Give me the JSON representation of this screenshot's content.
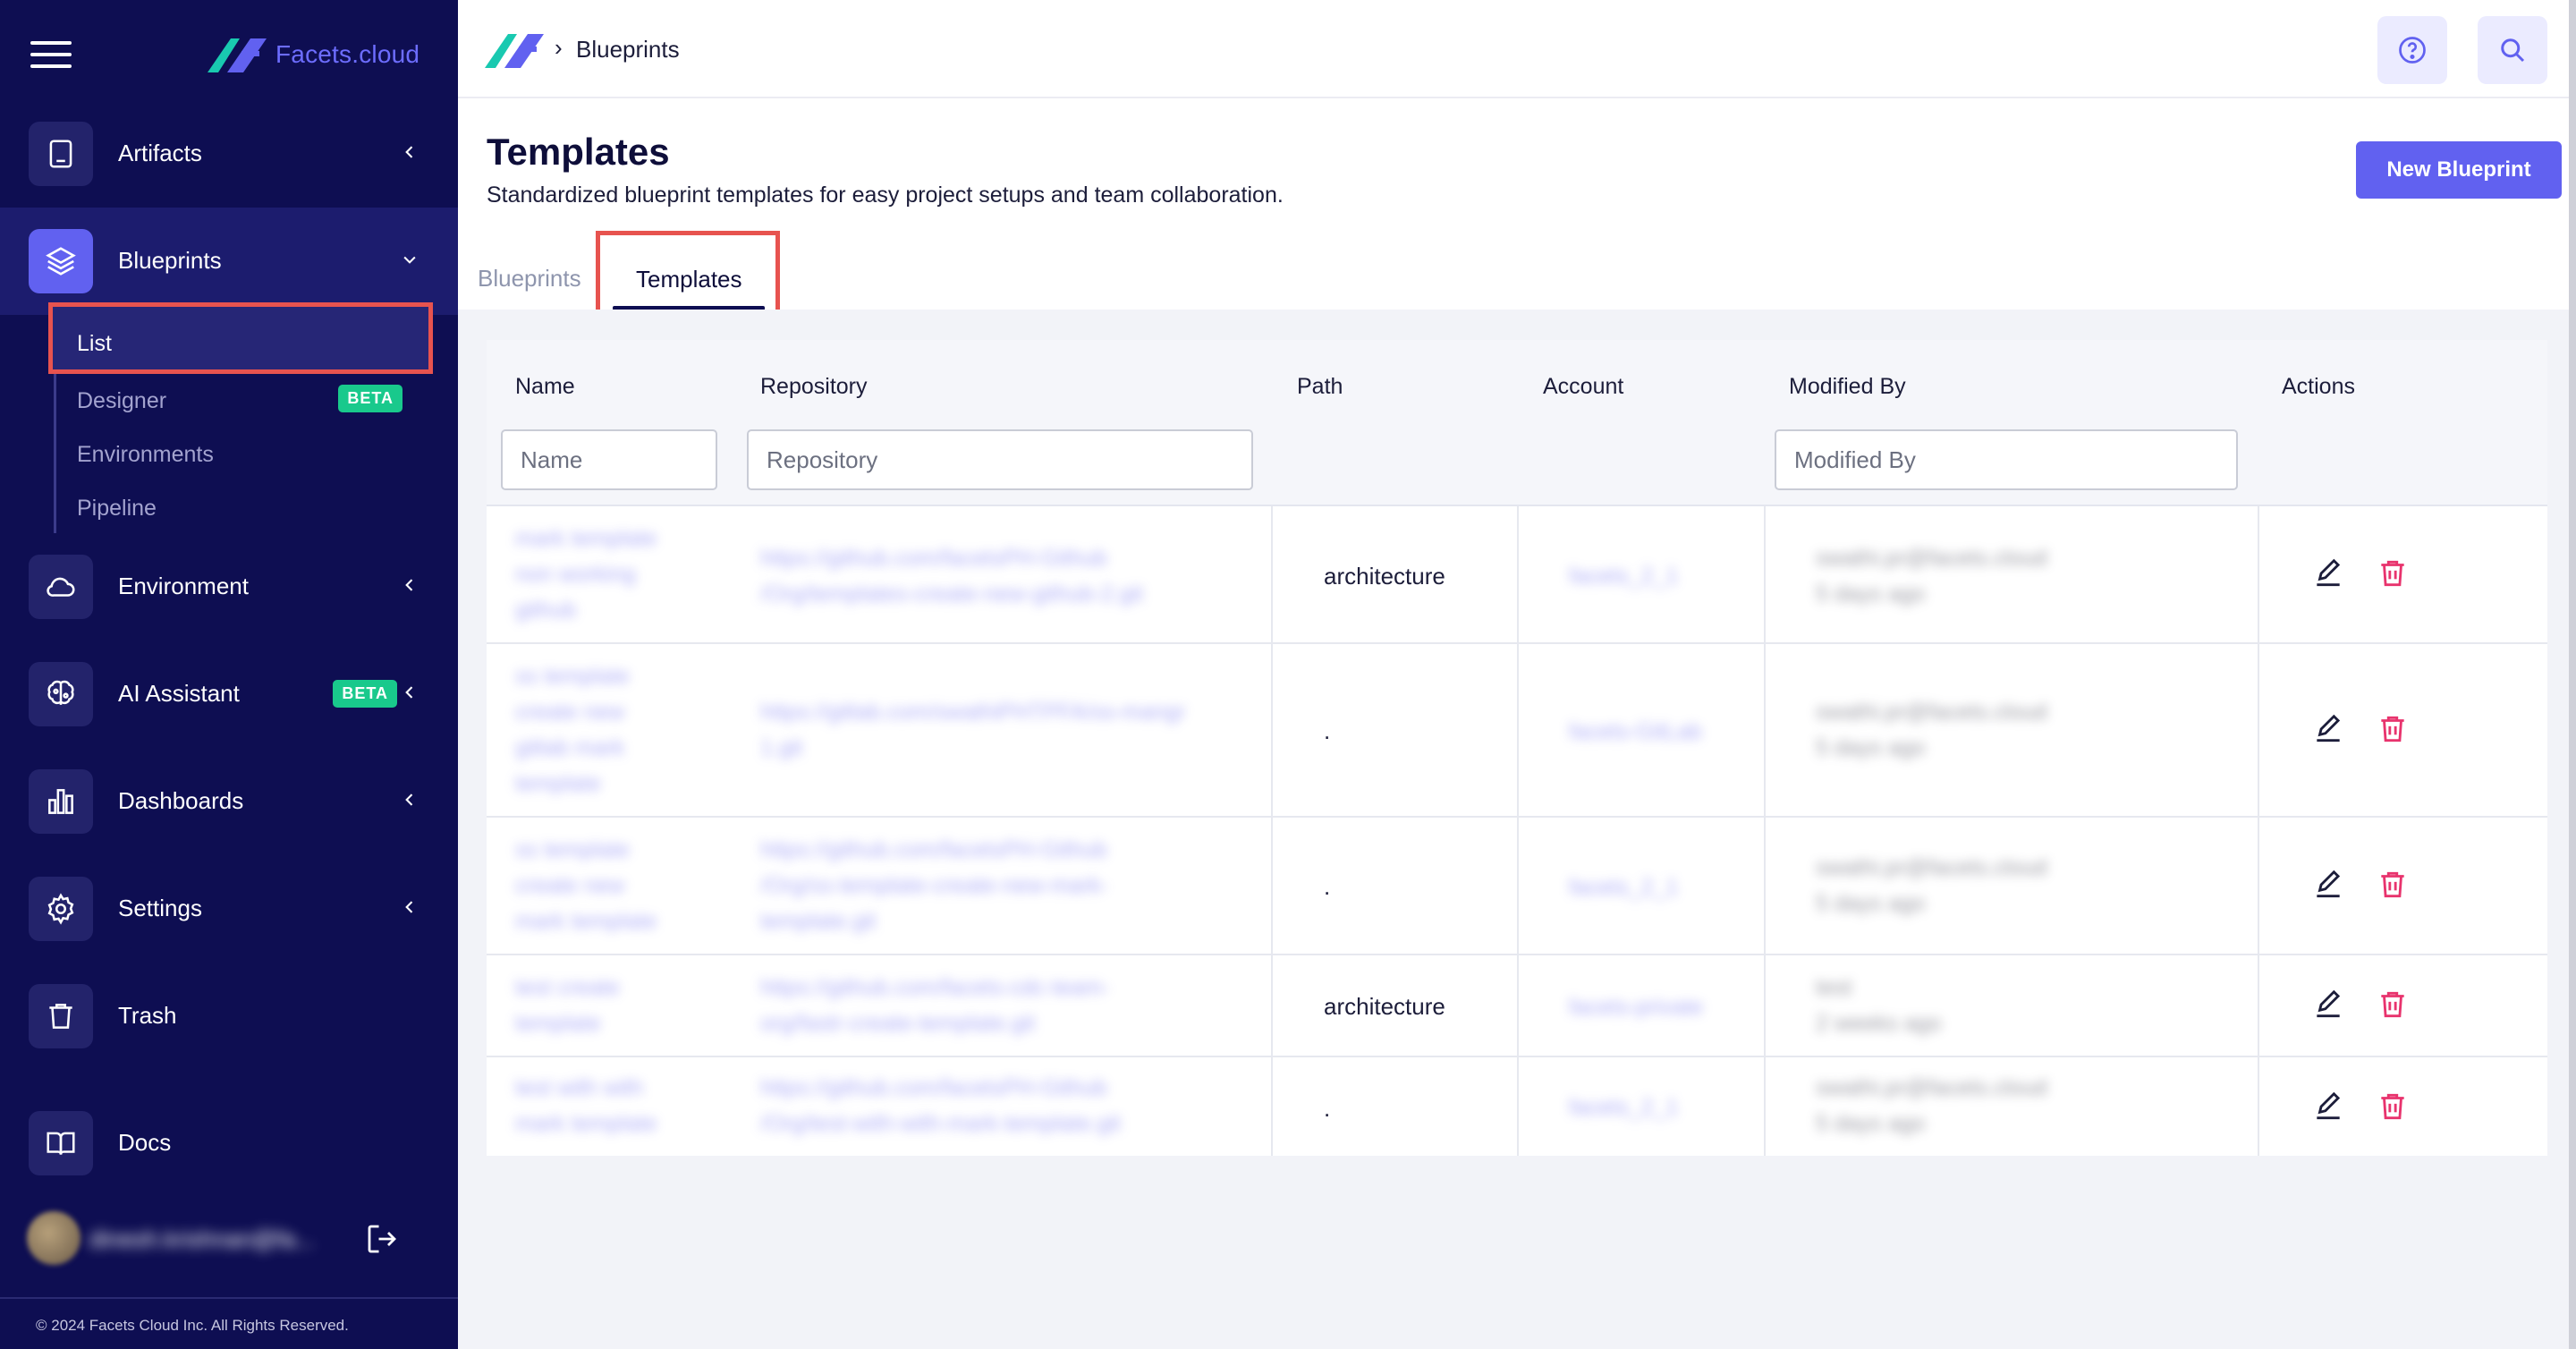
{
  "brand": {
    "name": "Facets.cloud",
    "accent": "#6d6dff"
  },
  "sidebar": {
    "items": [
      {
        "label": "Artifacts",
        "icon": "book-icon"
      },
      {
        "label": "Blueprints",
        "icon": "layers-icon"
      },
      {
        "label": "Environment",
        "icon": "cloud-icon"
      },
      {
        "label": "AI Assistant",
        "icon": "brain-icon",
        "badge": "BETA"
      },
      {
        "label": "Dashboards",
        "icon": "bar-chart-icon"
      },
      {
        "label": "Settings",
        "icon": "gear-icon"
      },
      {
        "label": "Trash",
        "icon": "trash-icon"
      },
      {
        "label": "Docs",
        "icon": "open-book-icon"
      }
    ],
    "subitems": [
      {
        "label": "List"
      },
      {
        "label": "Designer",
        "badge": "BETA"
      },
      {
        "label": "Environments"
      },
      {
        "label": "Pipeline"
      }
    ],
    "user": {
      "name": "dinesh.krishnan@fa..."
    },
    "footer": "© 2024 Facets Cloud Inc. All Rights Reserved."
  },
  "topbar": {
    "breadcrumb": "Blueprints",
    "breadcrumb_sep": "›"
  },
  "page": {
    "title": "Templates",
    "subtitle": "Standardized blueprint templates for easy project setups and team collaboration.",
    "new_button": "New Blueprint"
  },
  "tabs": {
    "blueprints": "Blueprints",
    "templates": "Templates"
  },
  "table": {
    "columns": {
      "name": "Name",
      "repository": "Repository",
      "path": "Path",
      "account": "Account",
      "modified_by": "Modified By",
      "actions": "Actions"
    },
    "filters": {
      "name": "Name",
      "repository": "Repository",
      "modified_by": "Modified By"
    },
    "rows": [
      {
        "name": [
          "mark template",
          "non working",
          "github"
        ],
        "repo": [
          "https://github.com/facetsPH-Github",
          "/Org/templates-create-new-github-2.git"
        ],
        "path": "architecture",
        "account": "facets_2_1",
        "modified_by": "swathi.pr@facets.cloud",
        "modified_when": "5 days ago"
      },
      {
        "name": [
          "ss template",
          "create new",
          "gitlab mark",
          "template"
        ],
        "repo": [
          "https://gitlab.com/swathiPHTPFA/ss-mangr",
          "1.git"
        ],
        "path": ".",
        "account": "facets-GitLab",
        "modified_by": "swathi.pr@facets.cloud",
        "modified_when": "5 days ago"
      },
      {
        "name": [
          "ss template",
          "create new",
          "mark template"
        ],
        "repo": [
          "https://github.com/facetsPH-Github",
          "/Org/ss-template-create-new-mark-",
          "template.git"
        ],
        "path": ".",
        "account": "facets_2_1",
        "modified_by": "swathi.pr@facets.cloud",
        "modified_when": "5 days ago"
      },
      {
        "name": [
          "test create",
          "template"
        ],
        "repo": [
          "https://github.com/facets-cdc-team-",
          "org/fastr-create-template.git"
        ],
        "path": "architecture",
        "account": "facets-private",
        "modified_by": "test",
        "modified_when": "2 weeks ago"
      },
      {
        "name": [
          "test with with",
          "mark template"
        ],
        "repo": [
          "https://github.com/facetsPH-Github",
          "/Org/test-with-with-mark-template.git"
        ],
        "path": ".",
        "account": "facets_2_1",
        "modified_by": "swathi.pr@facets.cloud",
        "modified_when": "5 days ago"
      }
    ],
    "actions": {
      "edit": "pencil-icon",
      "delete": "trash-icon"
    }
  },
  "colors": {
    "sidebar_bg": "#0e0e52",
    "primary": "#6161f0",
    "highlight": "#e7534f",
    "beta_badge": "#19c98c",
    "delete": "#e8336d"
  }
}
